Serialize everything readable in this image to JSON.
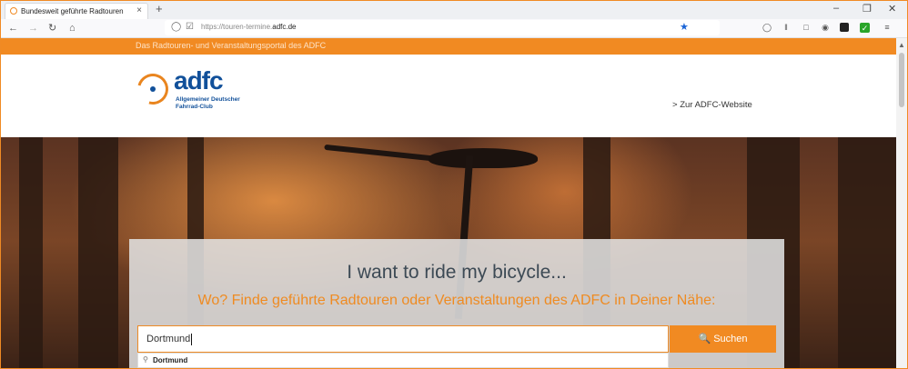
{
  "browser": {
    "tab_title": "Bundesweit geführte Radtouren",
    "tab_close": "×",
    "new_tab": "+",
    "window_controls": {
      "minimize": "–",
      "restore": "❐",
      "close": "✕"
    },
    "nav": {
      "back": "←",
      "forward": "→",
      "reload": "↻",
      "home": "⌂"
    },
    "url_prefix": "https://touren-termine.",
    "url_domain": "adfc.de",
    "bookmark_star": "★",
    "accent_color": "#1a64d6",
    "toolbar_icons": [
      "pocket-icon",
      "library-icon",
      "sidebar-icon",
      "extension-icon",
      "extension-dark-icon",
      "extension-green-icon",
      "menu-icon"
    ]
  },
  "page": {
    "topbar_text": "Das Radtouren- und Veranstaltungsportal des ADFC",
    "brand_color": "#f18a22",
    "logo": {
      "word": "adfc",
      "line1": "Allgemeiner Deutscher",
      "line2": "Fahrrad-Club"
    },
    "header_link": "Zur ADFC-Website",
    "header_link_chevron": ">",
    "hero": {
      "slogan": "I want to ride my bicycle...",
      "subtitle": "Wo? Finde geführte Radtouren oder Veranstaltungen des ADFC in Deiner Nähe:",
      "search_value": "Dortmund",
      "search_button": "Suchen",
      "search_icon": "🔍",
      "suggestion": "Dortmund"
    }
  }
}
